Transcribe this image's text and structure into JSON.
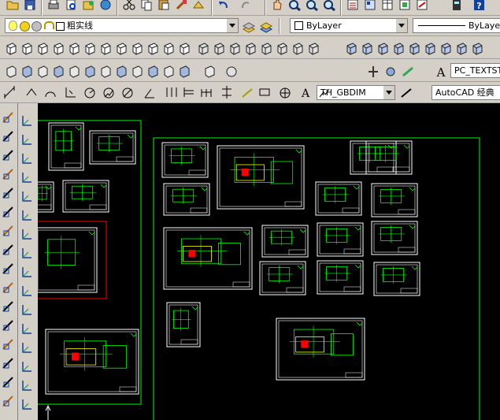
{
  "layers": {
    "current_layer": "粗实线"
  },
  "properties": {
    "color": "ByLayer",
    "linetype": "ByLayer"
  },
  "styles": {
    "text_style": "PC_TEXTSTY",
    "dim_style": "TH_GBDIM",
    "workspace": "AutoCAD 经典"
  },
  "colors": {
    "canvas_bg": "#000000",
    "frame_green": "#00ff00",
    "sheet_white": "#ffffff",
    "accent_red": "#ff0000",
    "accent_yellow": "#ffff00"
  }
}
